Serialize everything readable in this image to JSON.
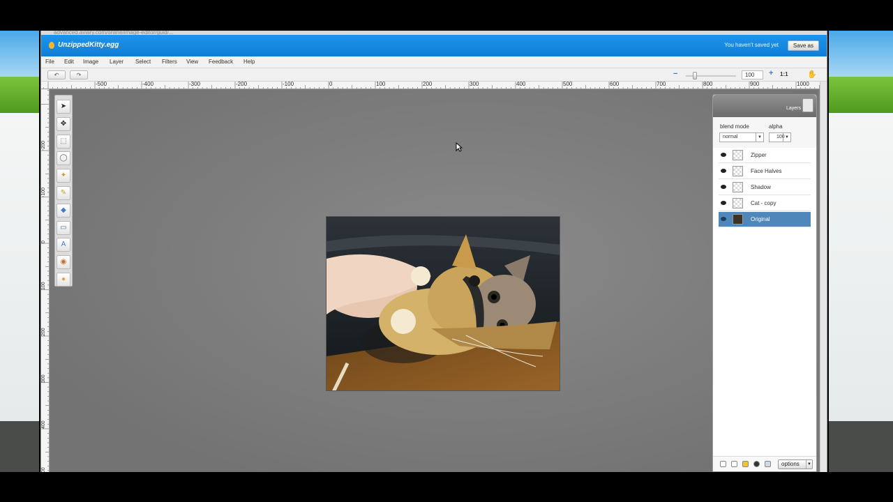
{
  "browser": {
    "url": "advanced.aviary.com/online/image-editor/guid/..."
  },
  "app": {
    "document_title": "UnzippedKitty.egg",
    "save_status": "You haven't saved yet",
    "save_button": "Save as"
  },
  "menu": [
    "File",
    "Edit",
    "Image",
    "Layer",
    "Select",
    "Filters",
    "View",
    "Feedback",
    "Help"
  ],
  "toolbar": {
    "undo_icon": "undo-icon",
    "redo_icon": "redo-icon",
    "zoom_value": "100",
    "zoom_actual": "1:1",
    "hand_icon": "hand-icon"
  },
  "rulers": {
    "horizontal": [
      "-500",
      "-400",
      "-300",
      "-200",
      "-100",
      "0",
      "100",
      "200",
      "300",
      "400",
      "500",
      "600",
      "700",
      "800",
      "900",
      "1000"
    ],
    "vertical": [
      "-200",
      "-100",
      "0",
      "100",
      "200",
      "300",
      "400",
      "500"
    ]
  },
  "tools": [
    "pointer-tool-icon",
    "move-tool-icon",
    "marquee-tool-icon",
    "lasso-tool-icon",
    "magic-wand-tool-icon",
    "brush-tool-icon",
    "fill-tool-icon",
    "shape-tool-icon",
    "text-tool-icon",
    "clone-tool-icon",
    "blur-tool-icon"
  ],
  "layers_panel": {
    "title": "Layers",
    "blend_mode_label": "blend mode",
    "blend_mode_value": "normal",
    "alpha_label": "alpha",
    "alpha_value": "100",
    "layers": [
      {
        "name": "Zipper",
        "selected": false
      },
      {
        "name": "Face Halves",
        "selected": false
      },
      {
        "name": "Shadow",
        "selected": false
      },
      {
        "name": "Cat - copy",
        "selected": false
      },
      {
        "name": "Original",
        "selected": true
      }
    ],
    "options_label": "options"
  },
  "colors": {
    "titlebar": "#1485e0",
    "selected_layer": "#4f87ba",
    "canvas": "#7b7b7b"
  }
}
